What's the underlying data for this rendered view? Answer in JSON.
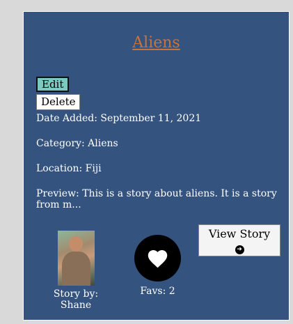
{
  "story": {
    "title": "Aliens",
    "date_added": "Date Added: September 11, 2021",
    "category": "Category: Aliens",
    "location": "Location: Fiji",
    "preview": "Preview: This is a story about aliens. It is a story from m..."
  },
  "actions": {
    "edit_label": "Edit",
    "delete_label": "Delete",
    "view_story_label": "View Story"
  },
  "author": {
    "story_by": "Story by: Shane"
  },
  "favorites": {
    "label": "Favs: 2"
  },
  "icons": {
    "favorite": "heart-icon",
    "view": "arrow-right-circle-icon",
    "avatar": "author-photo"
  },
  "colors": {
    "card_background": "#34547f",
    "title": "#c9733a",
    "edit_button": "#7cc9c2"
  }
}
